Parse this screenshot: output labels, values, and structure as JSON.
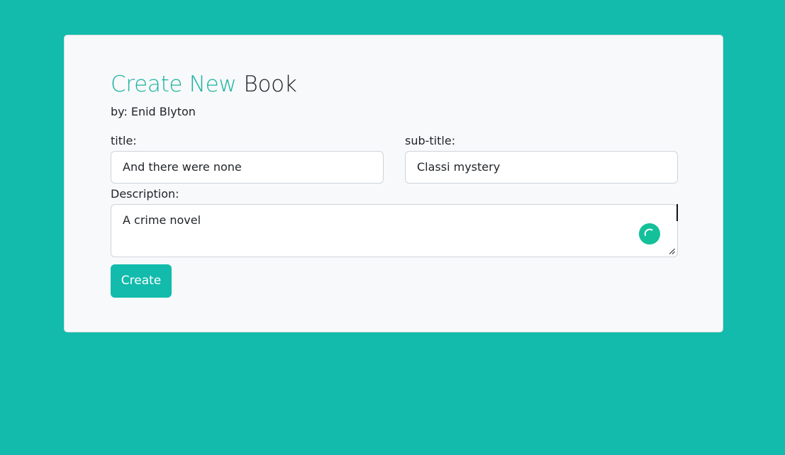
{
  "colors": {
    "page_background": "#12bbab",
    "accent": "#1bb3a3",
    "button": "#12bbab",
    "grammar_badge": "#14c09a"
  },
  "form": {
    "heading_accent": "Create New",
    "heading_rest": "Book",
    "author_prefix": "by:",
    "author_name": "Enid Blyton",
    "title_label": "title:",
    "title_value": "And there were none",
    "subtitle_label": "sub-title:",
    "subtitle_value": "Classi mystery",
    "description_label": "Description:",
    "description_value": "A crime novel",
    "submit_label": "Create"
  },
  "icons": {
    "textarea_badge": "loading-spinner-icon",
    "textarea_resize": "resize-handle-icon"
  }
}
